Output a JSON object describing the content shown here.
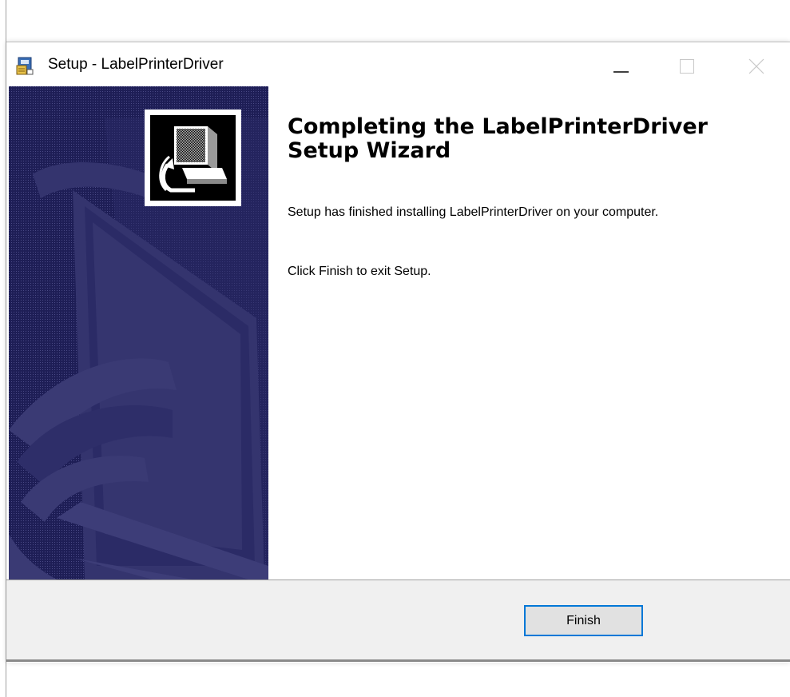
{
  "window": {
    "title": "Setup - LabelPrinterDriver"
  },
  "titlebar_buttons": {
    "minimize_icon": "minimize-icon",
    "maximize_icon": "maximize-icon",
    "close_icon": "close-icon"
  },
  "content": {
    "heading": "Completing the LabelPrinterDriver Setup Wizard",
    "paragraph_1": "Setup has finished installing LabelPrinterDriver on your computer.",
    "paragraph_2": "Click Finish to exit Setup."
  },
  "footer": {
    "finish_label": "Finish"
  },
  "colors": {
    "sidebar_background": "#20205a",
    "sidebar_shapes": "#34346e",
    "button_focus_border": "#0078d7",
    "footer_background": "#f0f0f0"
  },
  "icons": {
    "app": "setup-installer-icon",
    "wizard": "computer-install-icon"
  }
}
